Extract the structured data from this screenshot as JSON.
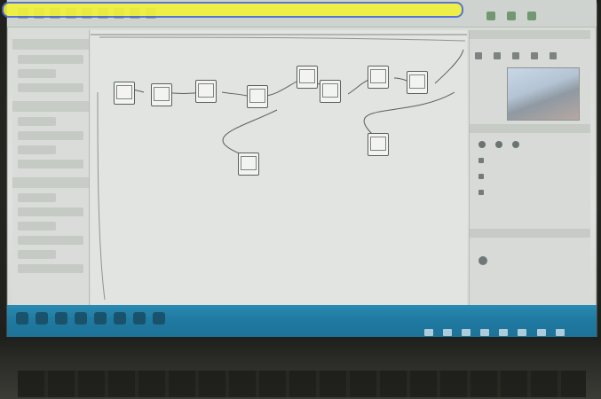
{
  "window": {
    "title": "",
    "toolbar_icons": [
      "new-icon",
      "open-icon",
      "save-icon",
      "cut-icon",
      "copy-icon",
      "paste-icon",
      "undo-icon",
      "redo-icon",
      "run-icon",
      "stop-icon"
    ]
  },
  "left_panel": {
    "sections": [
      {
        "title": "",
        "items": [
          "",
          "",
          ""
        ]
      },
      {
        "title": "",
        "items": [
          "",
          "",
          "",
          ""
        ]
      },
      {
        "title": "",
        "items": [
          "",
          "",
          "",
          "",
          "",
          ""
        ]
      }
    ]
  },
  "canvas": {
    "nodes": [
      {
        "id": "node-1",
        "label": ""
      },
      {
        "id": "node-2",
        "label": ""
      },
      {
        "id": "node-3",
        "label": ""
      },
      {
        "id": "node-4",
        "label": ""
      },
      {
        "id": "node-5",
        "label": ""
      },
      {
        "id": "node-6",
        "label": ""
      },
      {
        "id": "node-7",
        "label": ""
      },
      {
        "id": "node-8",
        "label": ""
      },
      {
        "id": "node-9",
        "label": ""
      },
      {
        "id": "node-10",
        "label": ""
      }
    ]
  },
  "right_panel": {
    "top_title": "",
    "properties_title": "",
    "tree_items": [
      "",
      "",
      ""
    ],
    "bottom_title": "",
    "bottom_item": ""
  },
  "taskbar": {
    "clock": ""
  },
  "colors": {
    "highlight": "#f2f23a",
    "highlight_border": "#4b6bd1",
    "taskbar": "#1f79a1"
  }
}
